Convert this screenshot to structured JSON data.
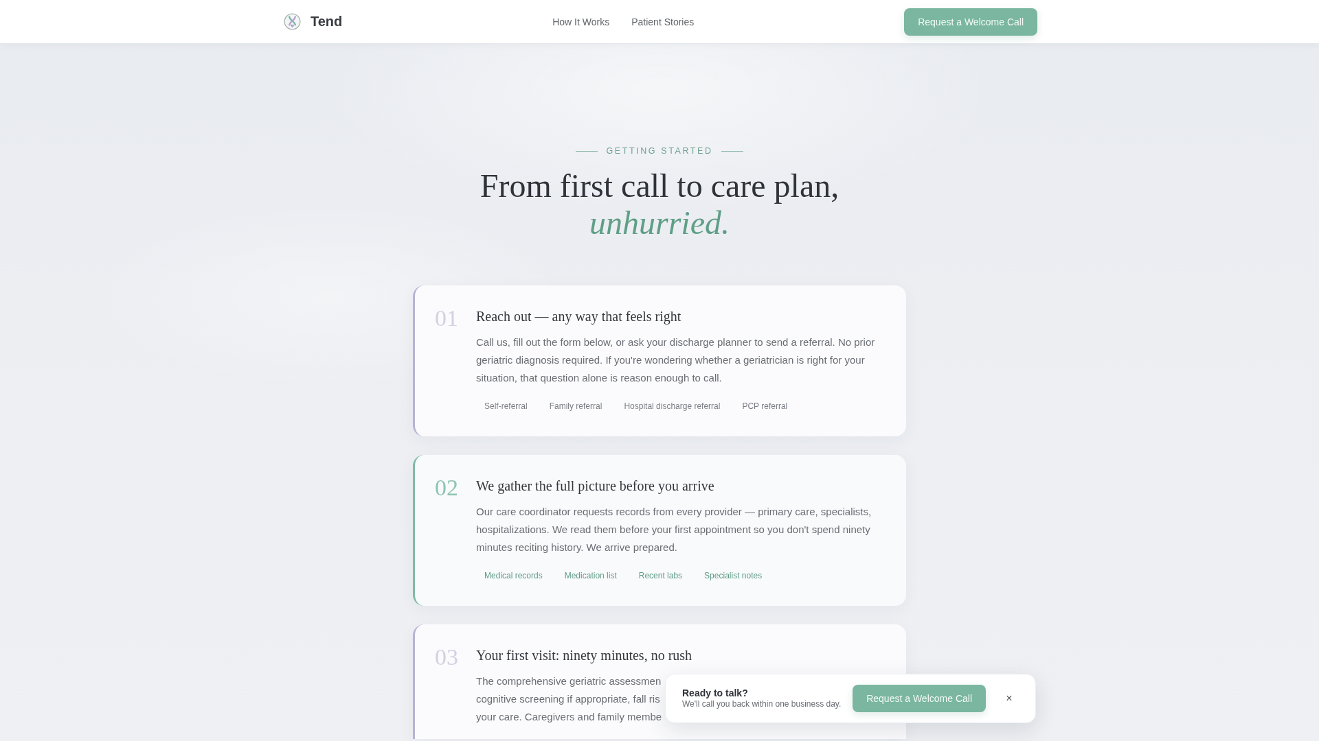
{
  "header": {
    "brand": "Tend",
    "nav": [
      "How It Works",
      "Patient Stories"
    ],
    "cta": "Request a Welcome Call"
  },
  "section": {
    "eyebrow": "GETTING STARTED",
    "heading": "From first call to care plan, *unhurried.*",
    "steps": [
      {
        "number": "01",
        "title": "Reach out — any way that feels right",
        "active": false,
        "body": "Call us, fill out the form below, or ask your discharge planner to send a referral. No prior geriatric diagnosis required. If you're wondering whether a geriatrician is right for your situation, that question alone is reason enough to call.",
        "tags": [
          "Self-referral",
          "Family referral",
          "Hospital discharge referral",
          "PCP referral"
        ]
      },
      {
        "number": "02",
        "title": "We gather the full picture before you arrive",
        "active": true,
        "body": "Our care coordinator requests records from every provider — primary care, specialists, hospitalizations. We read them before your first appointment so you don't spend ninety minutes reciting history. We arrive prepared.",
        "tags": [
          "Medical records",
          "Medication list",
          "Recent labs",
          "Specialist notes"
        ]
      },
      {
        "number": "03",
        "title": "Your first visit: ninety minutes, no rush",
        "active": false,
        "body_lines": [
          "The comprehensive geriatric assessmen",
          "cognitive screening if appropriate, fall ris",
          "your care. Caregivers and family membe"
        ]
      }
    ]
  },
  "popup": {
    "title": "Ready to talk?",
    "subtitle": "We'll call you back within one business day.",
    "button": "Request a Welcome Call",
    "close": "×"
  }
}
